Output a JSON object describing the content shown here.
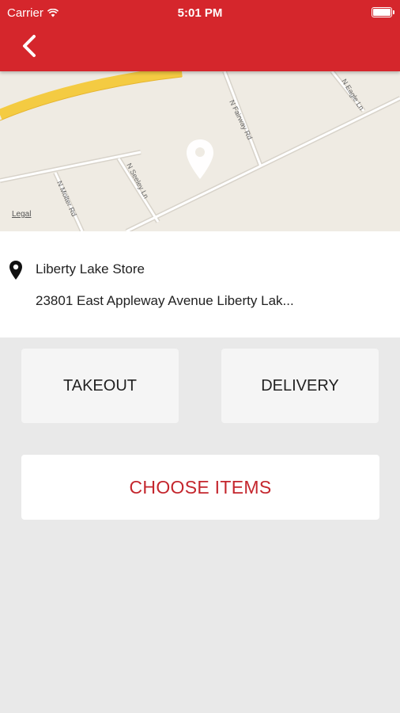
{
  "status_bar": {
    "carrier": "Carrier",
    "time": "5:01 PM"
  },
  "header": {
    "back_icon": "chevron-left-icon",
    "background_color": "#d5262c"
  },
  "map": {
    "legal_label": "Legal",
    "street_labels": [
      "N Fairway Rd",
      "N Eagle Ln",
      "N Seeley Ln",
      "N Molter Rd"
    ],
    "pin_icon": "map-pin-icon"
  },
  "store": {
    "pin_icon": "location-pin-icon",
    "name": "Liberty Lake Store",
    "address": "23801 East Appleway Avenue Liberty Lak..."
  },
  "order_options": {
    "takeout_label": "TAKEOUT",
    "delivery_label": "DELIVERY"
  },
  "choose_items": {
    "label": "CHOOSE ITEMS",
    "color": "#c4262d"
  }
}
